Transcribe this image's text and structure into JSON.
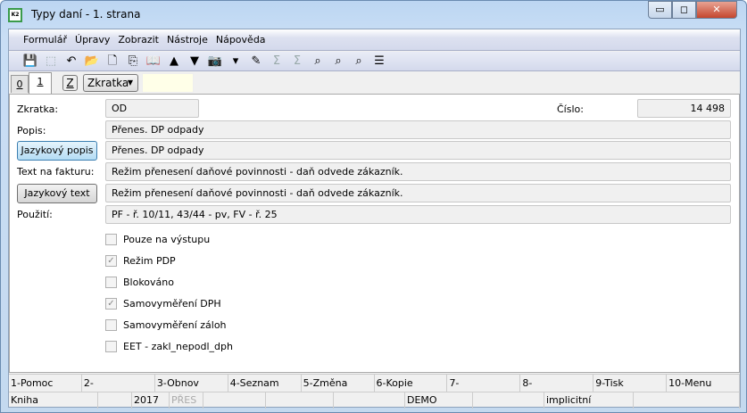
{
  "window": {
    "title": "Typy daní - 1. strana",
    "app_icon": "K2",
    "min": "▭",
    "max": "◻",
    "close": "✕"
  },
  "menu": [
    "Formulář",
    "Úpravy",
    "Zobrazit",
    "Nástroje",
    "Nápověda"
  ],
  "toolbar": [
    {
      "name": "save-icon",
      "glyph": "💾",
      "disabled": true
    },
    {
      "name": "save-as-icon",
      "glyph": "⬚",
      "disabled": true
    },
    {
      "name": "undo-icon",
      "glyph": "↶"
    },
    {
      "name": "open-folder-icon",
      "glyph": "📂"
    },
    {
      "name": "new-document-icon",
      "glyph": "🗋"
    },
    {
      "name": "copy-icon",
      "glyph": "⎘"
    },
    {
      "name": "book-icon",
      "glyph": "📖"
    },
    {
      "name": "arrow-up-icon",
      "glyph": "▲"
    },
    {
      "name": "arrow-down-icon",
      "glyph": "▼"
    },
    {
      "name": "camera-icon",
      "glyph": "📷"
    },
    {
      "name": "dropdown-arrow-icon",
      "glyph": "▾"
    },
    {
      "name": "excel-edit-icon",
      "glyph": "✎"
    },
    {
      "name": "sum-icon",
      "glyph": "Σ",
      "disabled": true
    },
    {
      "name": "sum-star-icon",
      "glyph": "Σ",
      "disabled": true
    },
    {
      "name": "binoculars-icon",
      "glyph": "⌕"
    },
    {
      "name": "binoculars-next-icon",
      "glyph": "⌕"
    },
    {
      "name": "binoculars-filter-icon",
      "glyph": "⌕"
    },
    {
      "name": "menu-lines-icon",
      "glyph": "☰"
    }
  ],
  "tabs": {
    "tab0": "0",
    "tab1": "1",
    "z": "Z",
    "combo": "Zkratka",
    "filter": ""
  },
  "form": {
    "zkratka_label": "Zkratka:",
    "zkratka": "OD",
    "cislo_label": "Číslo:",
    "cislo": "14 498",
    "popis_label": "Popis:",
    "popis": "Přenes. DP odpady",
    "jazykovy_popis_btn": "Jazykový popis",
    "jazykovy_popis": "Přenes. DP odpady",
    "text_label": "Text na fakturu:",
    "text": "Režim přenesení daňové povinnosti - daň odvede zákazník.",
    "jazykovy_text_btn": "Jazykový text",
    "jazykovy_text": "Režim přenesení daňové povinnosti - daň odvede zákazník.",
    "pouziti_label": "Použití:",
    "pouziti": "PF - ř. 10/11, 43/44 - pv, FV - ř. 25"
  },
  "checkboxes": [
    {
      "label": "Pouze na výstupu",
      "checked": false
    },
    {
      "label": "Režim PDP",
      "checked": true
    },
    {
      "label": "Blokováno",
      "checked": false
    },
    {
      "label": "Samovyměření DPH",
      "checked": true
    },
    {
      "label": "Samovyměření záloh",
      "checked": false
    },
    {
      "label": "EET - zakl_nepodl_dph",
      "checked": false
    }
  ],
  "fkeys": [
    "1-Pomoc",
    "2-",
    "3-Obnov",
    "4-Seznam",
    "5-Změna",
    "6-Kopie",
    "7-",
    "8-",
    "9-Tisk",
    "10-Menu"
  ],
  "status": [
    "Kniha",
    "",
    "2017",
    "PŘES",
    "",
    "",
    "",
    "DEMO",
    "",
    "implicitní",
    ""
  ]
}
